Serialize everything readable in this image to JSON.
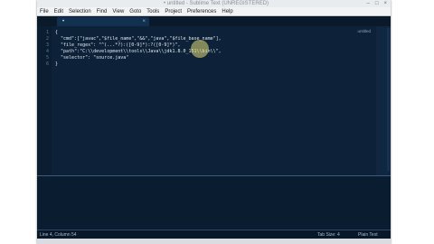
{
  "window": {
    "title": "• untitled - Sublime Text (UNREGISTERED)",
    "controls": [
      "–",
      "□",
      "×"
    ]
  },
  "menu": [
    "File",
    "Edit",
    "Selection",
    "Find",
    "View",
    "Goto",
    "Tools",
    "Project",
    "Preferences",
    "Help"
  ],
  "tab": {
    "title": "•",
    "close": "×"
  },
  "editor": {
    "syntax_label": "untitled",
    "lines": [
      {
        "num": "1",
        "text": "{"
      },
      {
        "num": "2",
        "text": "  \"cmd\":[\"javac\",\"$file_name\",\"&&\",\"java\",\"$file_base_name\"],"
      },
      {
        "num": "3",
        "text": "  \"file_regex\": \"^(...*?):([0-9]*):?([0-9]*)\","
      },
      {
        "num": "4",
        "text": "  \"path\":\"C:\\\\development\\\\tools\\\\Java\\\\jdk1.8.0_151\\\\bin\\\\\","
      },
      {
        "num": "5",
        "text": "  \"selector\": \"source.java\""
      },
      {
        "num": "6",
        "text": "}"
      }
    ]
  },
  "status": {
    "position": "Line 4, Column 54",
    "tab_size": "Tab Size: 4",
    "syntax": "Plain Text"
  }
}
